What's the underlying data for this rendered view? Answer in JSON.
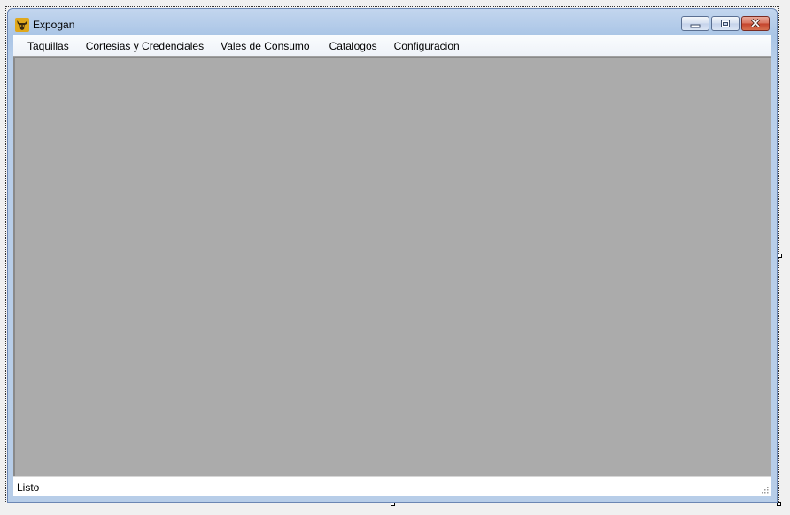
{
  "window": {
    "title": "Expogan",
    "icon": "bull-head-icon",
    "buttons": [
      "minimize",
      "maximize",
      "close"
    ]
  },
  "menu": {
    "items": [
      {
        "label": "Taquillas"
      },
      {
        "label": "Cortesias y Credenciales"
      },
      {
        "label": "Vales de Consumo"
      },
      {
        "label": "Catalogos"
      },
      {
        "label": "Configuracion"
      }
    ]
  },
  "statusbar": {
    "text": "Listo"
  },
  "colors": {
    "mdi_background": "#ababab",
    "close_button": "#c4432c",
    "title_gradient": "#aac5e6"
  }
}
